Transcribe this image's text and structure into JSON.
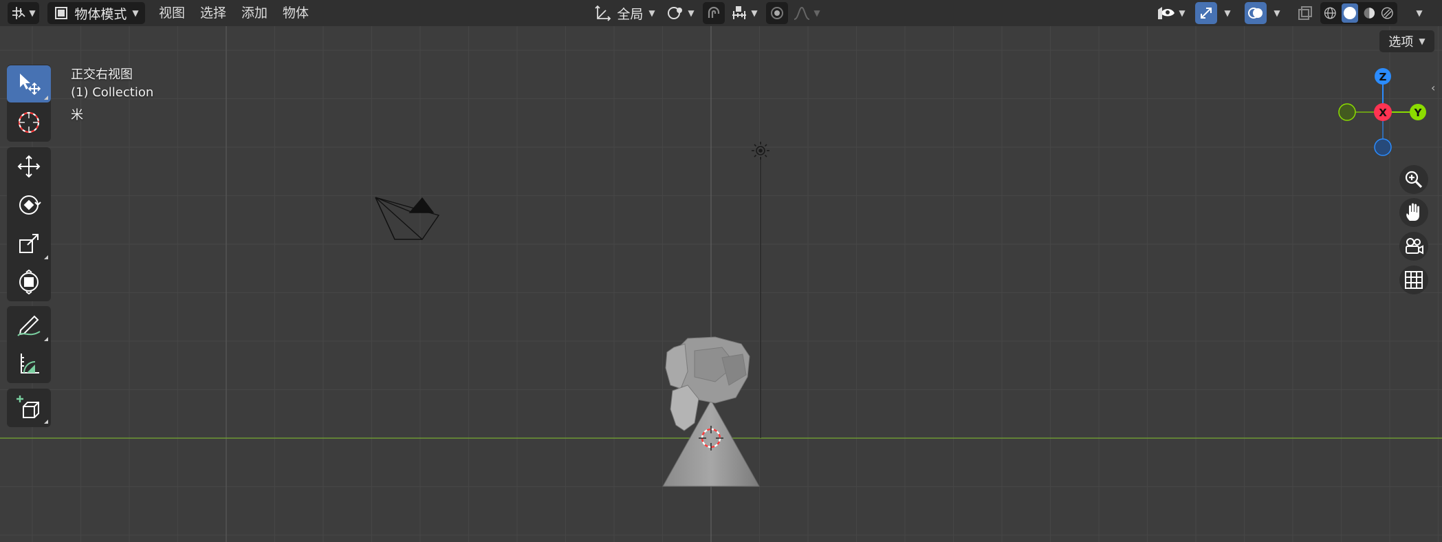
{
  "header": {
    "mode_label": "物体模式",
    "menu": {
      "view": "视图",
      "select": "选择",
      "add": "添加",
      "object": "物体"
    },
    "orientation_label": "全局"
  },
  "overlay": {
    "view_name": "正交右视图",
    "collection": "(1) Collection",
    "unit": "米"
  },
  "options_label": "选项",
  "gizmo": {
    "z": "Z",
    "x": "X",
    "y": "Y"
  },
  "colors": {
    "header_bg": "#303030",
    "viewport_bg": "#3d3d3d",
    "active_blue": "#4772b3",
    "axis_x": "#ff3352",
    "axis_y": "#8bdc00",
    "axis_z": "#2b8cff",
    "floor_line": "#6f9a34"
  },
  "icons": [
    "editor-type-icon",
    "object-mode-icon",
    "transform-orientation-icon",
    "pivot-icon",
    "snap-magnet-icon",
    "snap-increment-icon",
    "proportional-edit-icon",
    "falloff-icon",
    "visibility-eye-icon",
    "gizmo-toggle-icon",
    "overlay-toggle-icon",
    "xray-icon",
    "wireframe-shading-icon",
    "solid-shading-icon",
    "material-shading-icon",
    "rendered-shading-icon",
    "select-box-icon",
    "cursor-icon",
    "move-icon",
    "rotate-icon",
    "scale-icon",
    "transform-icon",
    "annotate-icon",
    "measure-icon",
    "add-cube-icon",
    "zoom-icon",
    "pan-hand-icon",
    "camera-view-icon",
    "ortho-grid-icon",
    "sun-light-icon",
    "camera-object-icon"
  ]
}
